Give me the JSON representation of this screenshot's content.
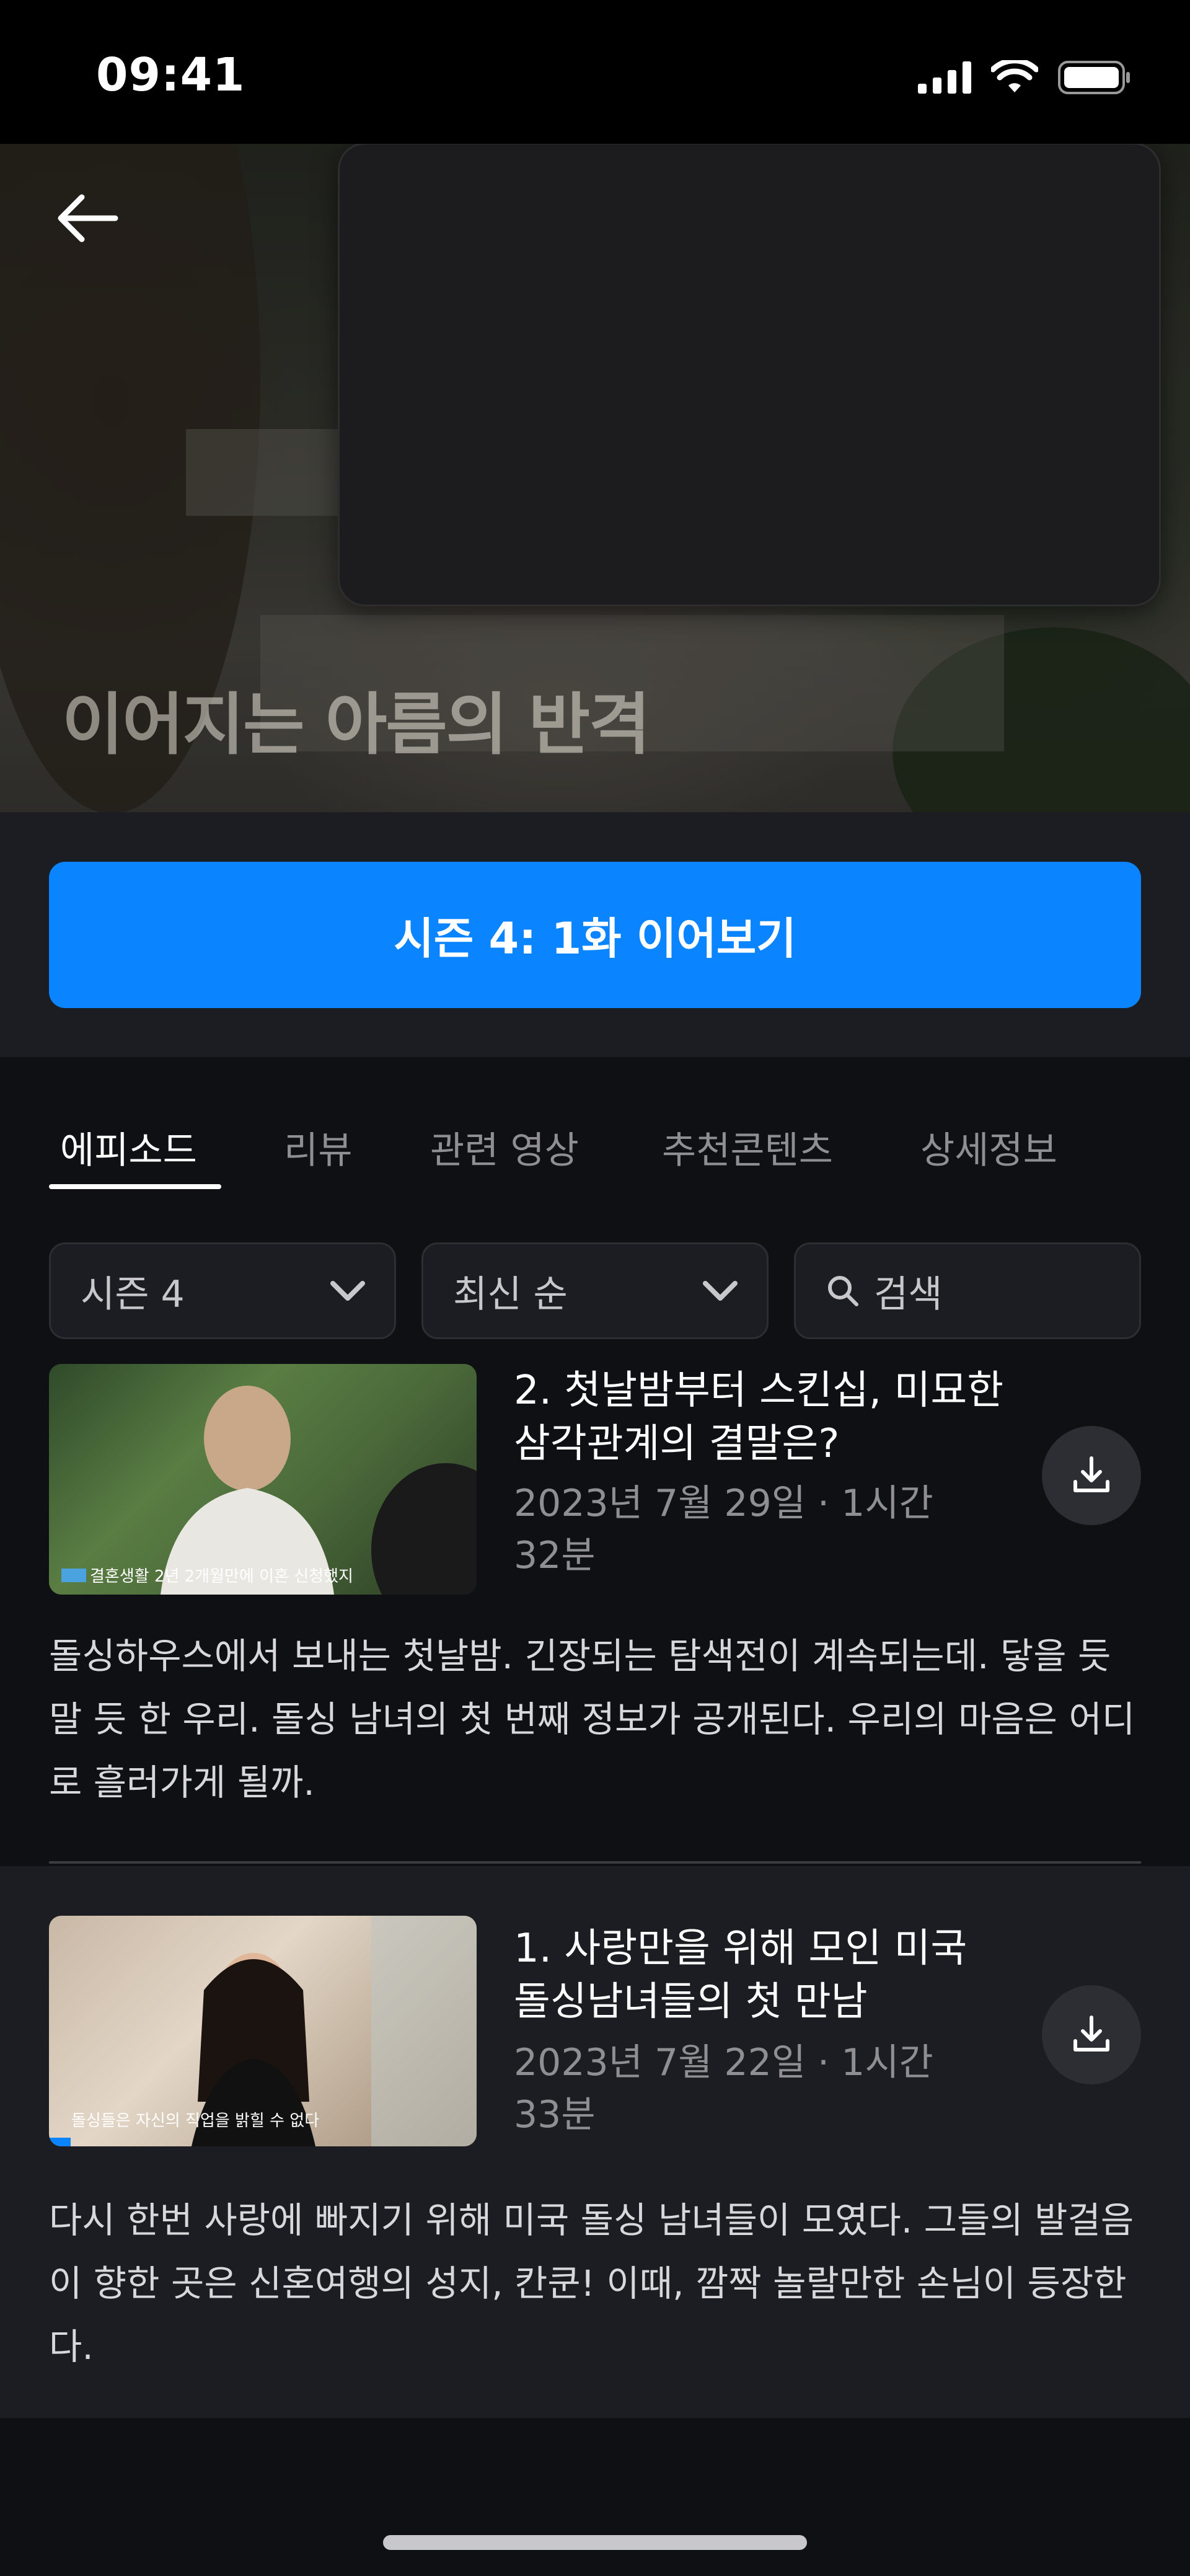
{
  "status": {
    "time": "09:41"
  },
  "hero": {
    "caption": "이어지는 아름의 반격"
  },
  "play_button": {
    "label": "시즌 4: 1화 이어보기"
  },
  "tabs": [
    {
      "label": "에피소드",
      "active": true
    },
    {
      "label": "리뷰"
    },
    {
      "label": "관련 영상"
    },
    {
      "label": "추천콘텐츠"
    },
    {
      "label": "상세정보"
    }
  ],
  "filters": {
    "season": "시즌 4",
    "sort": "최신 순",
    "search_placeholder": "검색"
  },
  "episodes": [
    {
      "title": "2. 첫날밤부터 스킨십, 미묘한 삼각관계의 결말은?",
      "meta": "2023년 7월 29일 · 1시간 32분",
      "description": "돌싱하우스에서 보내는 첫날밤. 긴장되는 탐색전이 계속되는데. 닿을 듯 말 듯 한 우리. 돌싱 남녀의 첫 번째 정보가 공개된다. 우리의 마음은 어디로 흘러가게 될까.",
      "thumb_caption": "결혼생활 2년 2개월만에 이혼 신청했지"
    },
    {
      "title": "1. 사랑만을 위해 모인 미국 돌싱남녀들의 첫 만남",
      "meta": "2023년 7월 22일 · 1시간 33분",
      "description": "다시 한번 사랑에 빠지기 위해 미국 돌싱 남녀들이 모였다. 그들의 발걸음이 향한 곳은 신혼여행의 성지, 칸쿤! 이때, 깜짝 놀랄만한 손님이 등장한다.",
      "thumb_caption": "돌싱들은 자신의 직업을 밝힐 수 없다",
      "progress": 0.05
    }
  ]
}
